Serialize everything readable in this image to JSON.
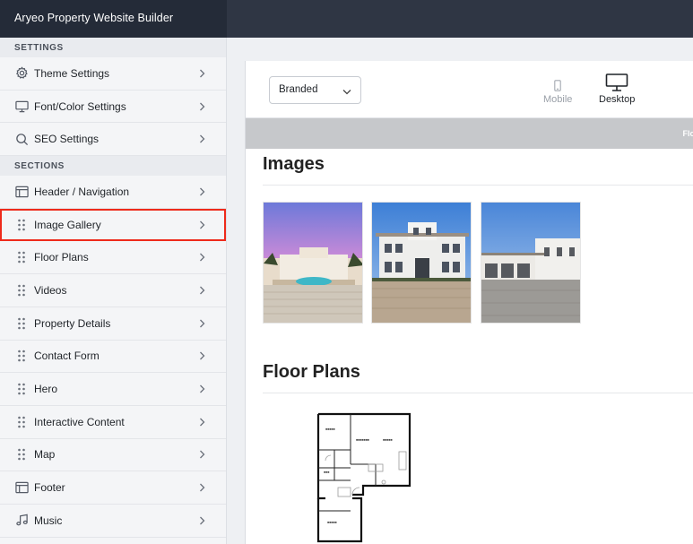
{
  "app": {
    "title": "Aryeo Property Website Builder"
  },
  "sidebar": {
    "settings_label": "SETTINGS",
    "settings": [
      {
        "label": "Theme Settings",
        "icon": "gear-icon"
      },
      {
        "label": "Font/Color Settings",
        "icon": "monitor-icon"
      },
      {
        "label": "SEO Settings",
        "icon": "search-icon"
      }
    ],
    "sections_label": "SECTIONS",
    "sections": [
      {
        "label": "Header / Navigation",
        "icon": "layout-icon"
      },
      {
        "label": "Image Gallery",
        "icon": "drag-handle-icon",
        "selected": true
      },
      {
        "label": "Floor Plans",
        "icon": "drag-handle-icon"
      },
      {
        "label": "Videos",
        "icon": "drag-handle-icon"
      },
      {
        "label": "Property Details",
        "icon": "drag-handle-icon"
      },
      {
        "label": "Contact Form",
        "icon": "drag-handle-icon"
      },
      {
        "label": "Hero",
        "icon": "drag-handle-icon"
      },
      {
        "label": "Interactive Content",
        "icon": "drag-handle-icon"
      },
      {
        "label": "Map",
        "icon": "drag-handle-icon"
      },
      {
        "label": "Footer",
        "icon": "layout-icon"
      },
      {
        "label": "Music",
        "icon": "music-note-icon"
      }
    ]
  },
  "toolbar": {
    "theme_select_value": "Branded",
    "device_mobile_label": "Mobile",
    "device_desktop_label": "Desktop",
    "active_device": "Desktop"
  },
  "preview": {
    "banner_text": "Flo",
    "images_heading": "Images",
    "floorplans_heading": "Floor Plans"
  },
  "colors": {
    "topbar": "#2f3644",
    "selection_outline": "#ee2a1b",
    "sidebar_bg": "#f4f5f7"
  }
}
